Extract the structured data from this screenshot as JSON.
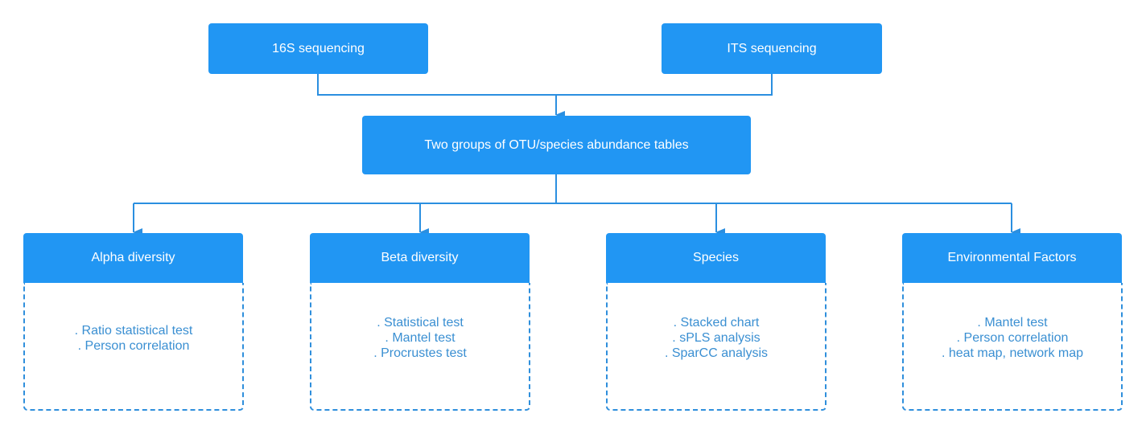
{
  "colors": {
    "box": "#2196f3",
    "line": "#2b8fe0",
    "list_text": "#3a8fd2"
  },
  "sources": [
    {
      "label": "16S sequencing"
    },
    {
      "label": "ITS sequencing"
    }
  ],
  "center": {
    "label": "Two groups of OTU/species abundance tables"
  },
  "analyses": [
    {
      "label": "Alpha diversity",
      "items": [
        ". Ratio statistical test",
        ". Person correlation"
      ]
    },
    {
      "label": "Beta diversity",
      "items": [
        ". Statistical test",
        ". Mantel test",
        ". Procrustes test"
      ]
    },
    {
      "label": "Species",
      "items": [
        ". Stacked chart",
        ". sPLS analysis",
        ". SparCC analysis"
      ]
    },
    {
      "label": "Environmental Factors",
      "items": [
        ". Mantel test",
        ". Person correlation",
        ". heat map, network map"
      ]
    }
  ]
}
